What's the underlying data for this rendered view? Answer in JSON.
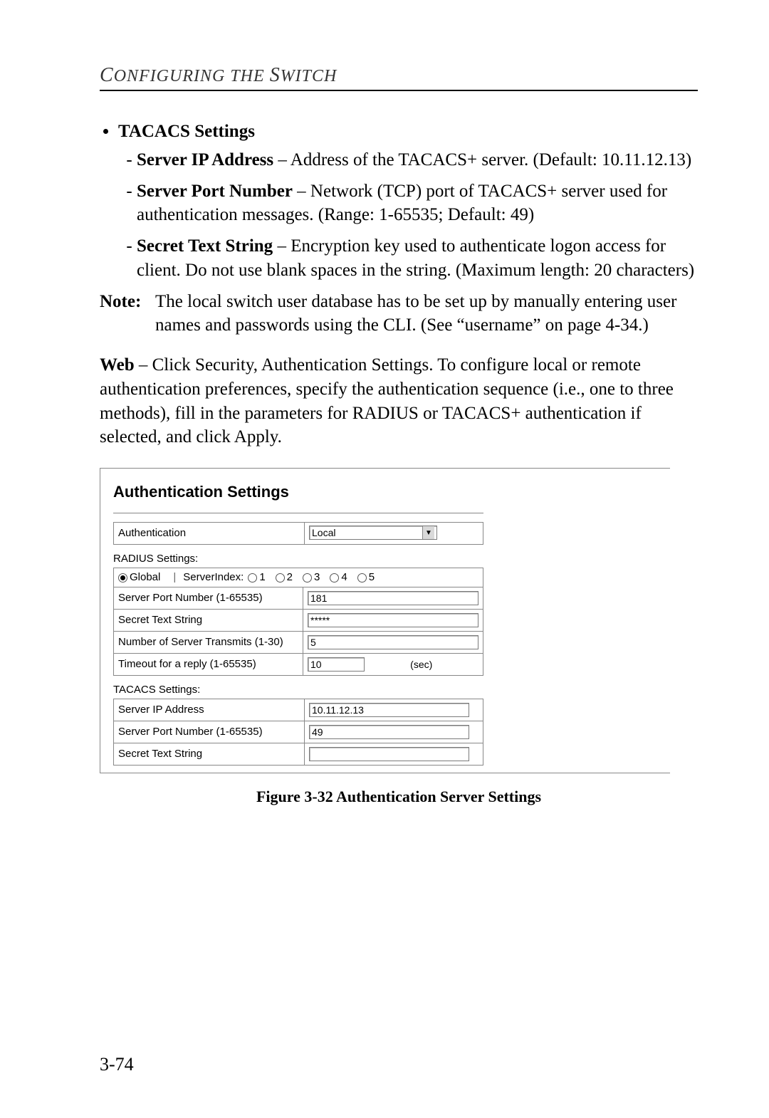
{
  "header": {
    "running_head": "Configuring the Switch"
  },
  "content": {
    "tacacs_heading": "TACACS Settings",
    "items": [
      {
        "term": "Server IP Address",
        "desc": " – Address of the TACACS+ server. (Default: 10.11.12.13)"
      },
      {
        "term": "Server Port Number",
        "desc": " – Network (TCP) port of TACACS+ server used for authentication messages. (Range: 1-65535; Default: 49)"
      },
      {
        "term": "Secret Text String",
        "desc": " – Encryption key used to authenticate logon access for client. Do not use blank spaces in the string. (Maximum length: 20 characters)"
      }
    ],
    "note_label": "Note:",
    "note_text": "The local switch user database has to be set up by manually entering user names and passwords using the CLI. (See “username” on page 4-34.)",
    "web_label": "Web",
    "web_text": " – Click Security, Authentication Settings. To configure local or remote authentication preferences, specify the authentication sequence (i.e., one to three methods), fill in the parameters for RADIUS or TACACS+ authentication if selected, and click Apply."
  },
  "figure": {
    "title": "Authentication Settings",
    "auth_label": "Authentication",
    "auth_value": "Local",
    "radius_section": "RADIUS Settings:",
    "global_label": "Global",
    "serverindex_label": "ServerIndex:",
    "server_indices": [
      "1",
      "2",
      "3",
      "4",
      "5"
    ],
    "radius_rows": [
      {
        "label": "Server Port Number (1-65535)",
        "value": "181"
      },
      {
        "label": "Secret Text String",
        "value": "*****"
      },
      {
        "label": "Number of Server Transmits (1-30)",
        "value": "5"
      },
      {
        "label": "Timeout for a reply (1-65535)",
        "value": "10",
        "unit": "(sec)"
      }
    ],
    "tacacs_section": "TACACS Settings:",
    "tacacs_rows": [
      {
        "label": "Server IP Address",
        "value": "10.11.12.13"
      },
      {
        "label": "Server Port Number (1-65535)",
        "value": "49"
      },
      {
        "label": "Secret Text String",
        "value": ""
      }
    ],
    "caption": "Figure 3-32   Authentication Server Settings"
  },
  "page_number": "3-74"
}
